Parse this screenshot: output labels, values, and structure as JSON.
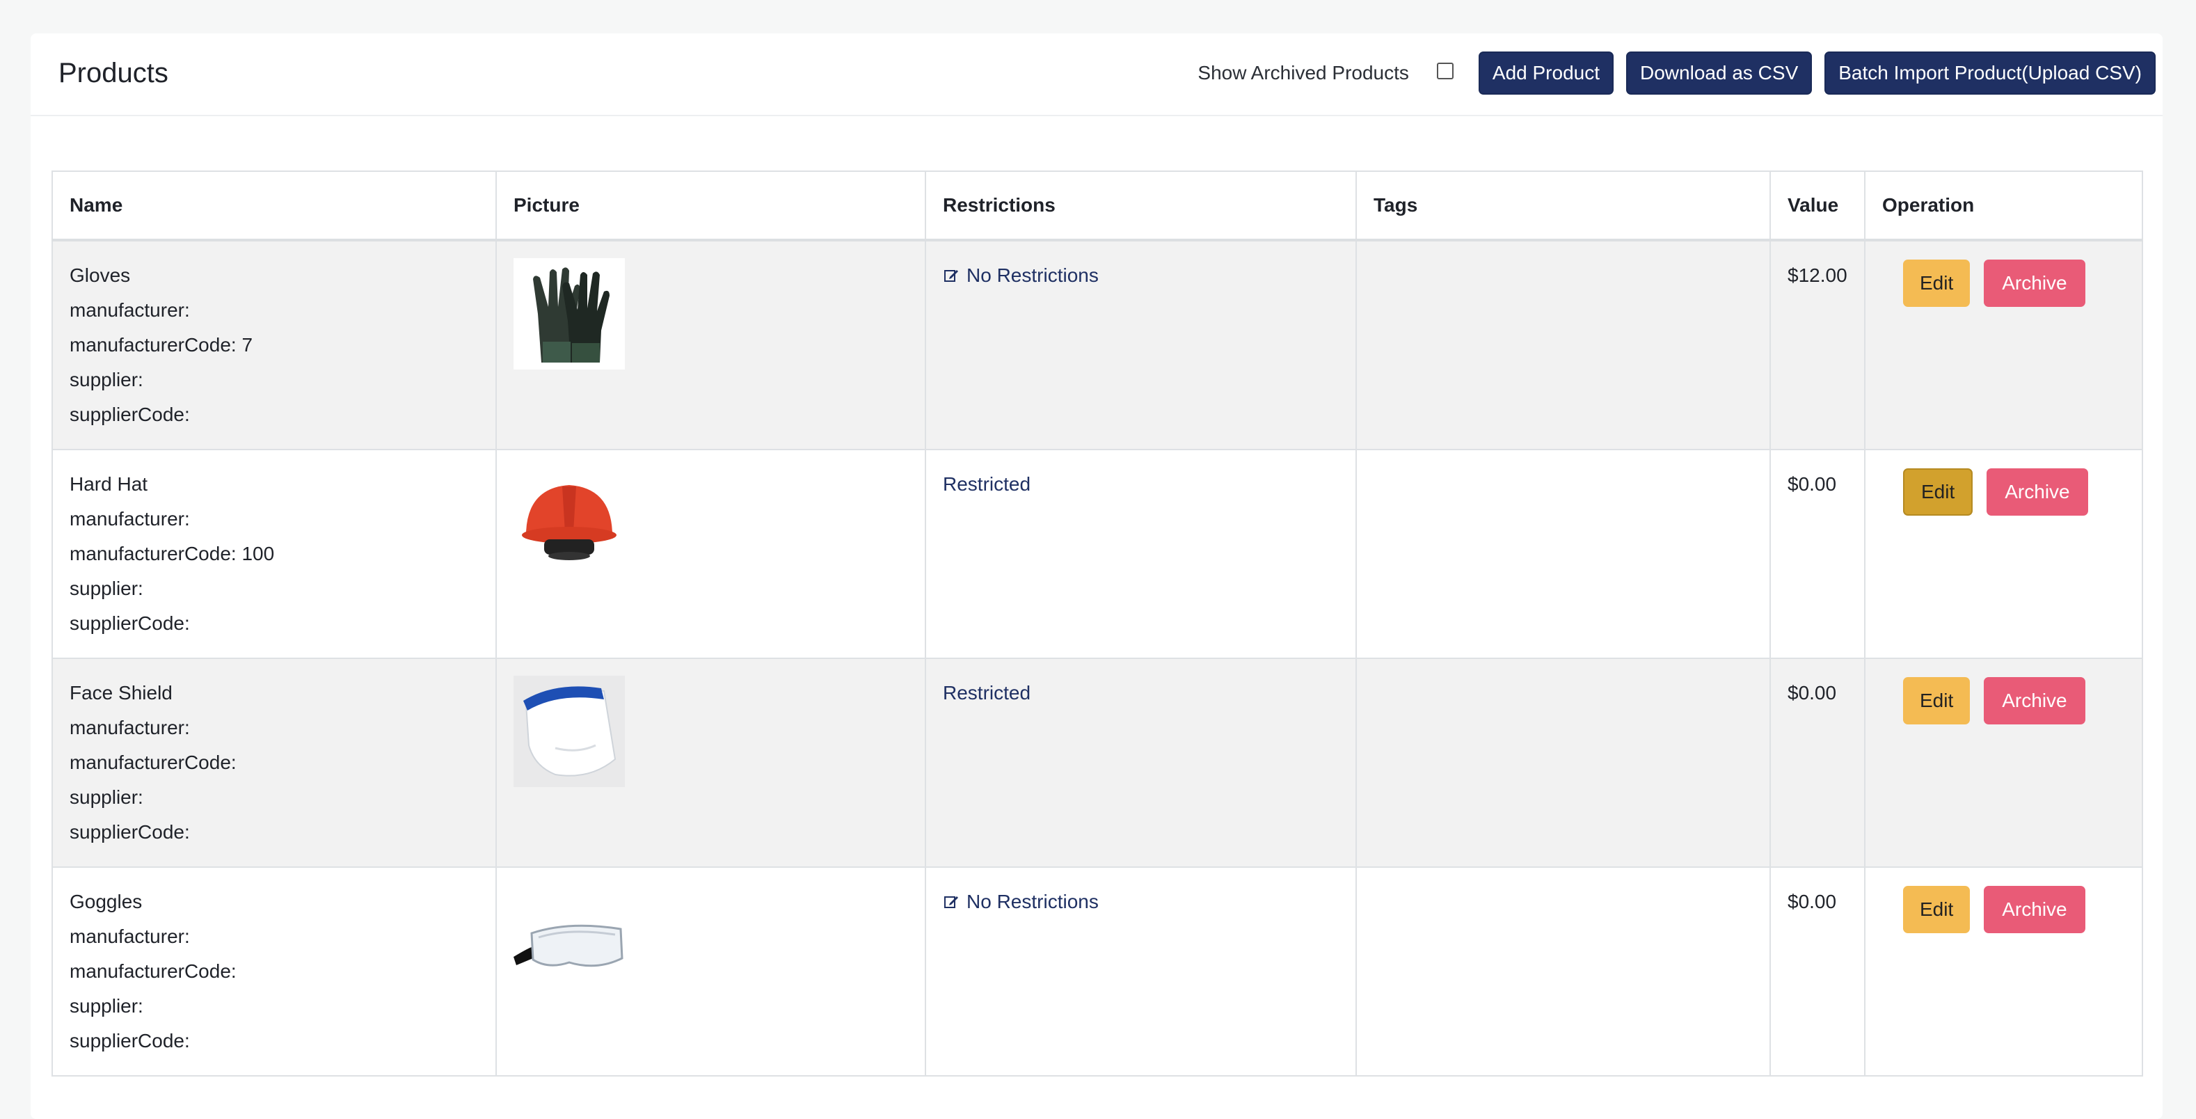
{
  "page": {
    "title": "Products"
  },
  "toolbar": {
    "show_archived_label": "Show Archived Products",
    "show_archived_checked": false,
    "add_product": "Add Product",
    "download_csv": "Download as CSV",
    "batch_import": "Batch Import Product(Upload CSV)"
  },
  "table": {
    "columns": [
      "Name",
      "Picture",
      "Restrictions",
      "Tags",
      "Value",
      "Operation"
    ],
    "rows": [
      {
        "name": "Gloves",
        "manufacturer": "manufacturer:",
        "manufacturer_code": "manufacturerCode: 7",
        "supplier": "supplier:",
        "supplier_code": "supplierCode:",
        "picture_icon": "gloves-image",
        "restriction": "No Restrictions",
        "restriction_icon": "edit-icon",
        "tags": "",
        "value": "$12.00",
        "edit": "Edit",
        "archive": "Archive"
      },
      {
        "name": "Hard Hat",
        "manufacturer": "manufacturer:",
        "manufacturer_code": "manufacturerCode: 100",
        "supplier": "supplier:",
        "supplier_code": "supplierCode:",
        "picture_icon": "hard-hat-image",
        "restriction": "Restricted",
        "tags": "",
        "value": "$0.00",
        "edit": "Edit",
        "archive": "Archive"
      },
      {
        "name": "Face Shield",
        "manufacturer": "manufacturer:",
        "manufacturer_code": "manufacturerCode:",
        "supplier": "supplier:",
        "supplier_code": "supplierCode:",
        "picture_icon": "face-shield-image",
        "restriction": "Restricted",
        "tags": "",
        "value": "$0.00",
        "edit": "Edit",
        "archive": "Archive"
      },
      {
        "name": "Goggles",
        "manufacturer": "manufacturer:",
        "manufacturer_code": "manufacturerCode:",
        "supplier": "supplier:",
        "supplier_code": "supplierCode:",
        "picture_icon": "goggles-image",
        "restriction": "No Restrictions",
        "restriction_icon": "edit-icon",
        "tags": "",
        "value": "$0.00",
        "edit": "Edit",
        "archive": "Archive"
      }
    ]
  },
  "colors": {
    "primary": "#1f3063",
    "edit": "#f4bb53",
    "archive": "#e95b77",
    "row_stripe": "#f2f2f2"
  }
}
